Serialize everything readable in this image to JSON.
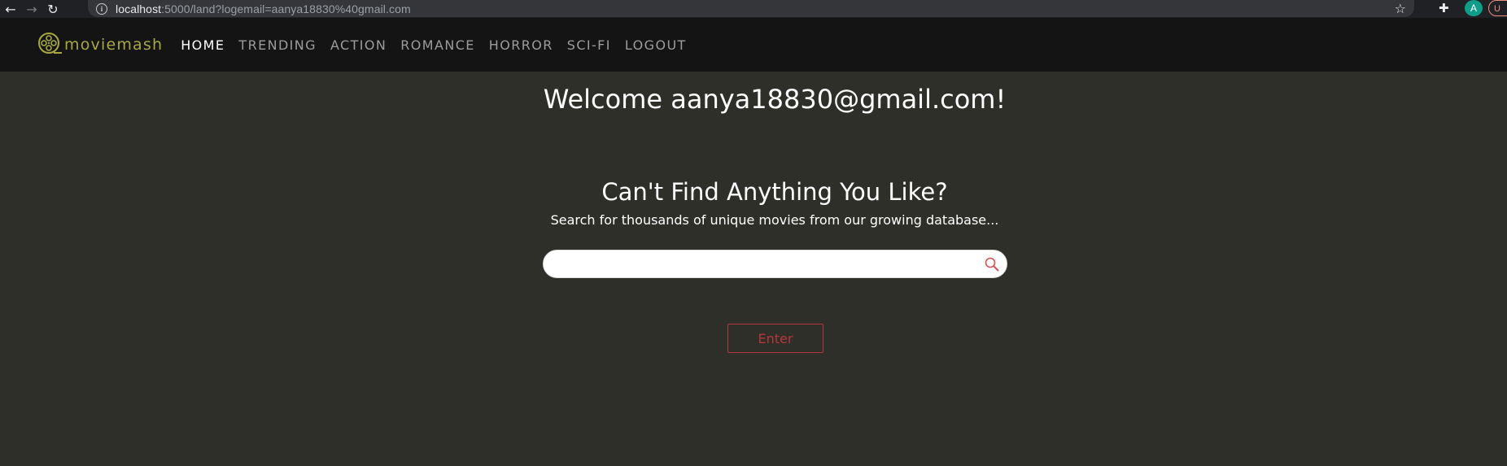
{
  "browser": {
    "back_glyph": "←",
    "forward_glyph": "→",
    "reload_glyph": "↻",
    "url_host": "localhost",
    "url_rest": ":5000/land?logemail=aanya18830%40gmail.com",
    "star_glyph": "☆",
    "extensions_glyph": "✚",
    "profile_initial": "A",
    "update_label": "U"
  },
  "site": {
    "logo_text": "moviemash",
    "brand_color": "#a7a940",
    "nav": [
      {
        "label": "HOME",
        "active": true
      },
      {
        "label": "TRENDING"
      },
      {
        "label": "ACTION"
      },
      {
        "label": "ROMANCE"
      },
      {
        "label": "HORROR"
      },
      {
        "label": "SCI-FI"
      },
      {
        "label": "LOGOUT"
      }
    ]
  },
  "main": {
    "welcome": "Welcome aanya18830@gmail.com!",
    "headline": "Can't Find Anything You Like?",
    "subtext": "Search for thousands of unique movies from our growing database...",
    "search_value": "",
    "search_placeholder": "",
    "enter_label": "Enter",
    "accent_color": "#b3363f"
  }
}
